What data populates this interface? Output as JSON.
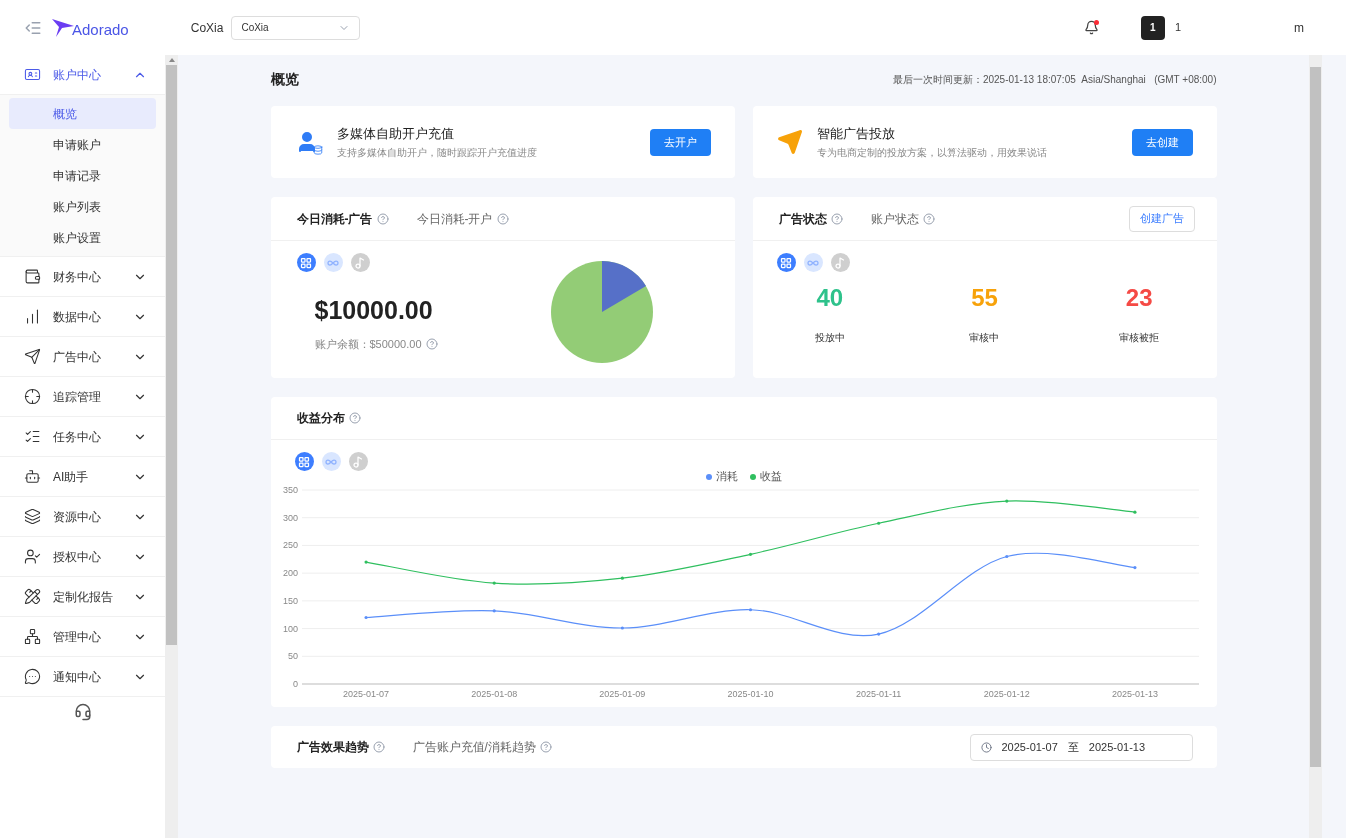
{
  "header": {
    "logo": "Adorado",
    "account_label": "CoXia",
    "account_select": {
      "value": "CoXia"
    },
    "notifications": {
      "unread": true
    },
    "user_badge": "1",
    "user_count": "1",
    "user_name": "m"
  },
  "sidebar": {
    "items": [
      {
        "label": "账户中心",
        "expanded": true,
        "children": [
          {
            "label": "概览",
            "selected": true
          },
          {
            "label": "申请账户",
            "selected": false
          },
          {
            "label": "申请记录",
            "selected": false
          },
          {
            "label": "账户列表",
            "selected": false
          },
          {
            "label": "账户设置",
            "selected": false
          }
        ]
      },
      {
        "label": "财务中心",
        "expanded": false
      },
      {
        "label": "数据中心",
        "expanded": false
      },
      {
        "label": "广告中心",
        "expanded": false
      },
      {
        "label": "追踪管理",
        "expanded": false
      },
      {
        "label": "任务中心",
        "expanded": false
      },
      {
        "label": "AI助手",
        "expanded": false
      },
      {
        "label": "资源中心",
        "expanded": false
      },
      {
        "label": "授权中心",
        "expanded": false
      },
      {
        "label": "定制化报告",
        "expanded": false
      },
      {
        "label": "管理中心",
        "expanded": false
      },
      {
        "label": "通知中心",
        "expanded": false
      }
    ]
  },
  "page": {
    "title": "概览",
    "updated": "最后一次时间更新：2025-01-13 18:07:05  Asia/Shanghai   (GMT +08:00)"
  },
  "promo_cards": [
    {
      "kind": "account",
      "title": "多媒体自助开户充值",
      "subtitle": "支持多媒体自助开户，随时跟踪开户充值进度",
      "button": "去开户"
    },
    {
      "kind": "ads",
      "title": "智能广告投放",
      "subtitle": "专为电商定制的投放方案，以算法驱动，用效果说话",
      "button": "去创建"
    }
  ],
  "spend_card": {
    "tabs": [
      {
        "label": "今日消耗-广告",
        "selected": true
      },
      {
        "label": "今日消耗-开户",
        "selected": false
      }
    ],
    "platforms": [
      {
        "selected": true
      },
      {
        "selected": false
      },
      {
        "selected": false
      }
    ],
    "amount": "$10000.00",
    "balance": "账户余额：$50000.00"
  },
  "status_card": {
    "tabs": [
      {
        "label": "广告状态",
        "selected": true
      },
      {
        "label": "账户状态",
        "selected": false
      }
    ],
    "button": "创建广告",
    "platforms": [
      {
        "selected": true
      },
      {
        "selected": false
      },
      {
        "selected": false
      }
    ],
    "stats": [
      {
        "value": "40",
        "label": "投放中",
        "color": "#2ec28b"
      },
      {
        "value": "55",
        "label": "审核中",
        "color": "#f7a20a"
      },
      {
        "value": "23",
        "label": "审核被拒",
        "color": "#f54a45"
      }
    ]
  },
  "revenue_card": {
    "title": "收益分布",
    "platforms": [
      {
        "selected": true
      },
      {
        "selected": false
      },
      {
        "selected": false
      }
    ],
    "chart_data": {
      "type": "line",
      "categories": [
        "2025-01-07",
        "2025-01-08",
        "2025-01-09",
        "2025-01-10",
        "2025-01-11",
        "2025-01-12",
        "2025-01-13"
      ],
      "series": [
        {
          "name": "消耗",
          "color": "#5b8ff9",
          "values": [
            120,
            132,
            101,
            134,
            90,
            230,
            210
          ]
        },
        {
          "name": "收益",
          "color": "#2fbf5f",
          "values": [
            220,
            182,
            191,
            234,
            290,
            330,
            310
          ]
        }
      ],
      "grid": true,
      "legend": true,
      "ylim": [
        0,
        350
      ],
      "yticks": [
        0,
        50,
        100,
        150,
        200,
        250,
        300,
        350
      ]
    }
  },
  "trend_card": {
    "tabs": [
      {
        "label": "广告效果趋势",
        "selected": true
      },
      {
        "label": "广告账户充值/消耗趋势",
        "selected": false
      }
    ],
    "date_from": "2025-01-07",
    "date_sep": "至",
    "date_to": "2025-01-13"
  }
}
